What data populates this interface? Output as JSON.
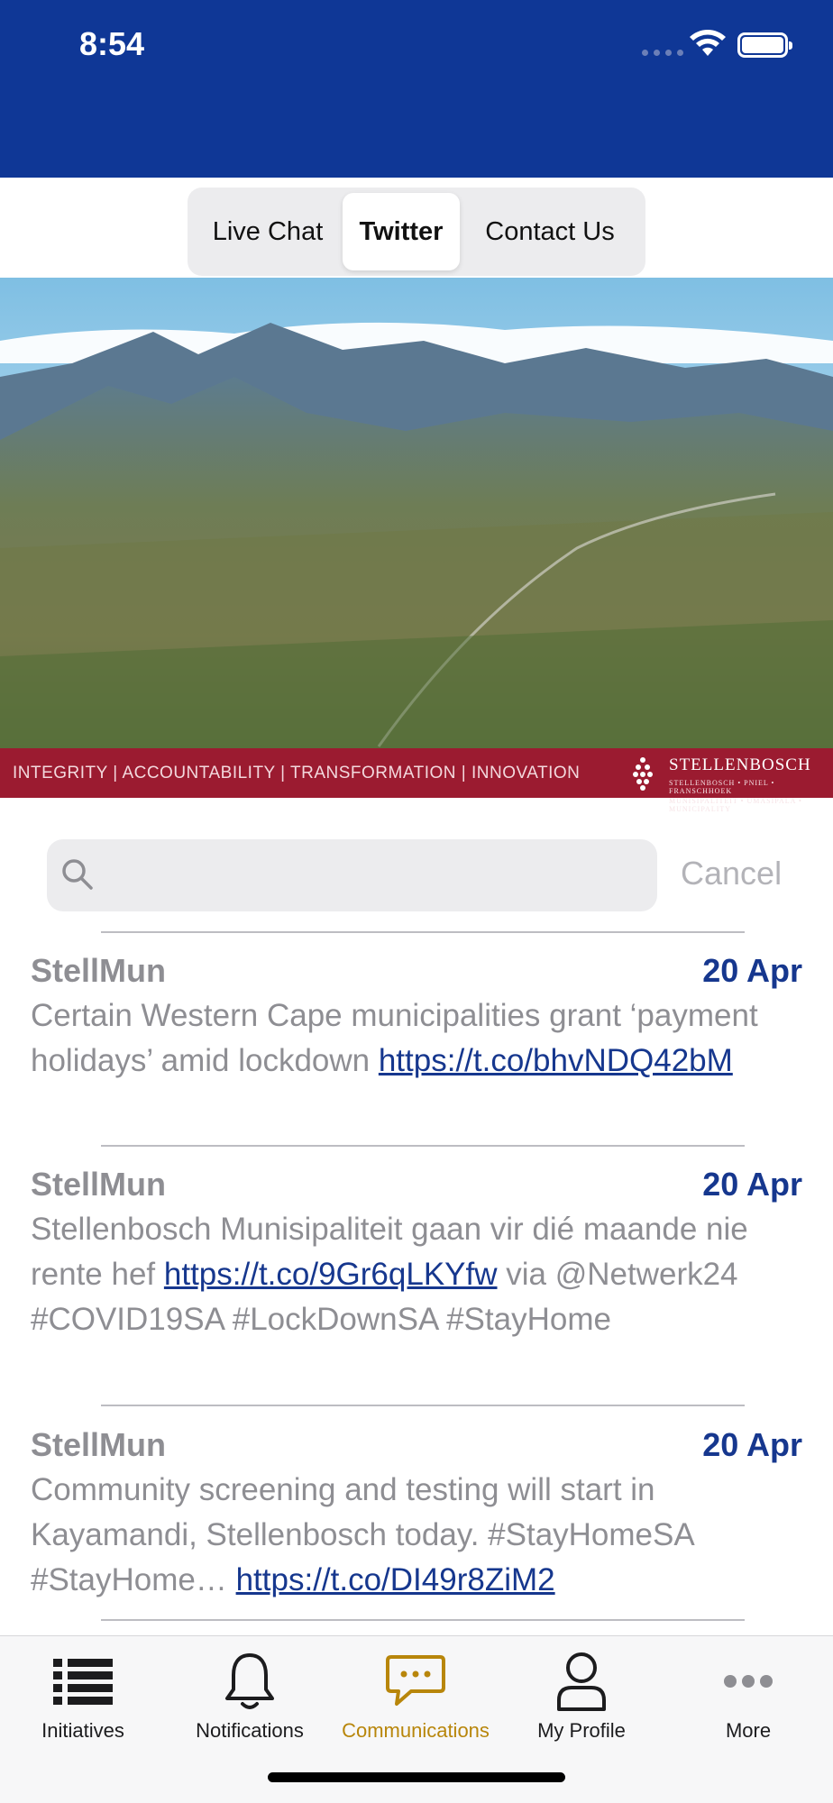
{
  "status_bar": {
    "time": "8:54"
  },
  "segments": [
    "Live Chat",
    "Twitter",
    "Contact Us"
  ],
  "banner": {
    "tagline": "INTEGRITY  |  ACCOUNTABILITY  |  TRANSFORMATION  |  INNOVATION",
    "brand": "STELLENBOSCH",
    "brand_sub": "STELLENBOSCH • PNIEL • FRANSCHHOEK",
    "brand_sub2": "MUNISIPALITEIT • UMASIPALA • MUNICIPALITY"
  },
  "search": {
    "placeholder": "",
    "value": "",
    "cancel_label": "Cancel"
  },
  "tweets": [
    {
      "user": "StellMun",
      "date": "20 Apr",
      "text": "Certain Western Cape municipalities grant ‘payment holidays’ amid lockdown ",
      "link": "https://t.co/bhvNDQ42bM",
      "after": ""
    },
    {
      "user": "StellMun",
      "date": "20 Apr",
      "text": "Stellenbosch Munisipaliteit gaan vir dié maande nie rente hef ",
      "link": "https://t.co/9Gr6qLKYfw",
      "after": " via @Netwerk24 #COVID19SA #LockDownSA #StayHome"
    },
    {
      "user": "StellMun",
      "date": "20 Apr",
      "text": "Community screening and testing will start in Kayamandi, Stellenbosch today. #StayHomeSA #StayHome… ",
      "link": "https://t.co/DI49r8ZiM2",
      "after": ""
    }
  ],
  "tabbar": {
    "items": [
      {
        "label": "Initiatives",
        "icon": "list-icon"
      },
      {
        "label": "Notifications",
        "icon": "bell-icon"
      },
      {
        "label": "Communications",
        "icon": "chat-bubble-icon"
      },
      {
        "label": "My Profile",
        "icon": "person-icon"
      },
      {
        "label": "More",
        "icon": "more-icon"
      }
    ],
    "active_color": "#b8860b"
  },
  "colors": {
    "header": "#0f3796",
    "link": "#16378e",
    "tagline_bar": "#9b1b30"
  }
}
